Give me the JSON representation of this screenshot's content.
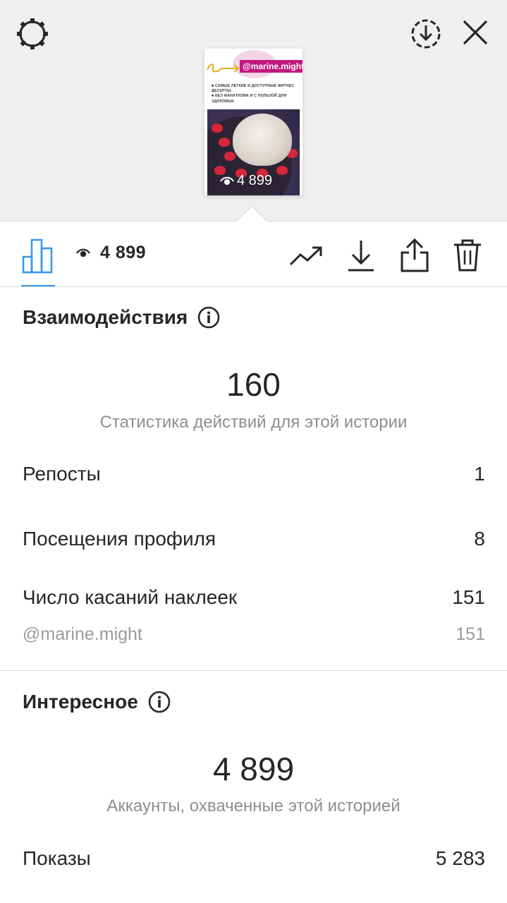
{
  "header": {
    "settings_icon": "settings-gear-icon",
    "download_icon": "download-circle-icon",
    "close_icon": "close-icon"
  },
  "story": {
    "handle": "@marine.might",
    "caption_line1": "■ Самые лёгкие и доступные фитнес десерты.",
    "caption_line2": "■ Без фанатизма и с пользой для здоровья.",
    "views": "4 899"
  },
  "toolbar": {
    "views": "4 899",
    "icons": [
      "bar-chart-icon",
      "eye-icon",
      "trend-icon",
      "download-icon",
      "share-icon",
      "trash-icon"
    ]
  },
  "interactions": {
    "title": "Взаимодействия",
    "total": "160",
    "subtitle": "Статистика действий для этой истории",
    "rows": [
      {
        "label": "Репосты",
        "value": "1"
      },
      {
        "label": "Посещения профиля",
        "value": "8"
      },
      {
        "label": "Число касаний наклеек",
        "value": "151"
      }
    ],
    "sub_row": {
      "label": "@marine.might",
      "value": "151"
    }
  },
  "discovery": {
    "title": "Интересное",
    "total": "4 899",
    "subtitle": "Аккаунты, охваченные этой историей",
    "rows": [
      {
        "label": "Показы",
        "value": "5 283"
      }
    ]
  },
  "colors": {
    "accent": "#3897f0",
    "handle_bg": "#c2187f",
    "text": "#262626",
    "secondary": "#8e8e8e",
    "background_top": "#efefef"
  }
}
